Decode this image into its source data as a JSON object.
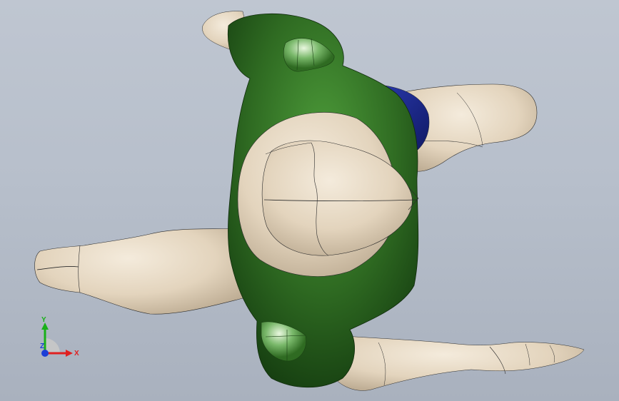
{
  "viewport": {
    "background_top": "#bfc6d1",
    "background_bottom": "#a9b1be"
  },
  "model": {
    "skin_color": "#e6d8c2",
    "shirt_color": "#2f6b22",
    "shorts_color": "#1c2a8c",
    "outline_color": "#2b2b2b"
  },
  "triad": {
    "x_label": "X",
    "y_label": "Y",
    "z_label": "Z",
    "x_color": "#e02020",
    "y_color": "#18b018",
    "z_color": "#1d3fd6"
  }
}
